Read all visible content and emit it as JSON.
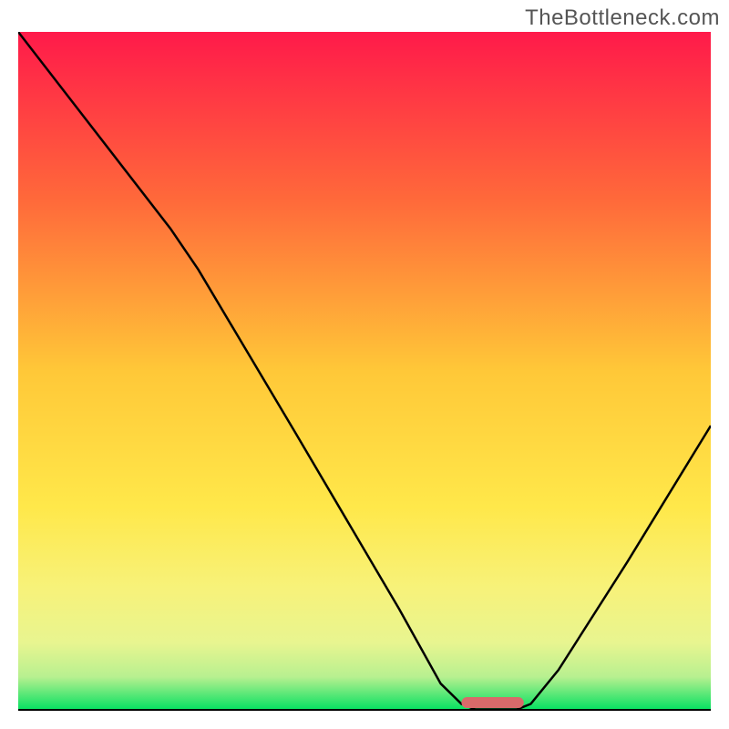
{
  "watermark": "TheBottleneck.com",
  "chart_data": {
    "type": "line",
    "title": "",
    "xlabel": "",
    "ylabel": "",
    "xlim": [
      0,
      100
    ],
    "ylim": [
      0,
      100
    ],
    "gradient_stops": [
      {
        "offset": 0,
        "color": "#ff1a4a"
      },
      {
        "offset": 25,
        "color": "#ff6a3a"
      },
      {
        "offset": 50,
        "color": "#ffc838"
      },
      {
        "offset": 70,
        "color": "#ffe84a"
      },
      {
        "offset": 82,
        "color": "#f7f27a"
      },
      {
        "offset": 90,
        "color": "#e8f590"
      },
      {
        "offset": 95,
        "color": "#b8f090"
      },
      {
        "offset": 100,
        "color": "#00e060"
      }
    ],
    "curve": [
      {
        "x": 0,
        "y": 100
      },
      {
        "x": 22,
        "y": 71
      },
      {
        "x": 26,
        "y": 65
      },
      {
        "x": 40,
        "y": 41
      },
      {
        "x": 55,
        "y": 15
      },
      {
        "x": 61,
        "y": 4
      },
      {
        "x": 64,
        "y": 1
      },
      {
        "x": 66,
        "y": 0.2
      },
      {
        "x": 72,
        "y": 0.2
      },
      {
        "x": 74,
        "y": 1
      },
      {
        "x": 78,
        "y": 6
      },
      {
        "x": 88,
        "y": 22
      },
      {
        "x": 100,
        "y": 42
      }
    ],
    "marker": {
      "x_start": 64,
      "x_end": 73,
      "y": 1.2,
      "color": "#d86a6a"
    }
  }
}
